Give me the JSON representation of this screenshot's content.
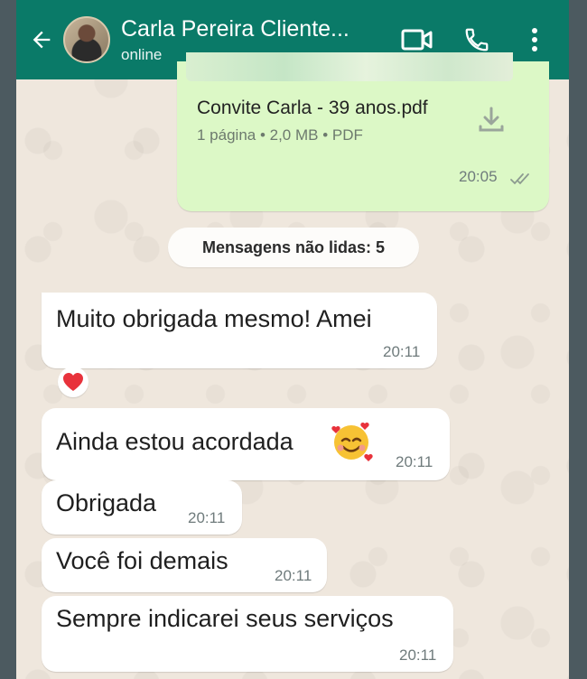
{
  "header": {
    "contact_name": "Carla Pereira Cliente...",
    "status": "online"
  },
  "icons": {
    "back": "arrow-left-icon",
    "video": "video-call-icon",
    "phone": "phone-icon",
    "menu": "more-vert-icon",
    "download": "download-icon",
    "read_receipt": "double-check-icon",
    "reaction": "red-heart"
  },
  "colors": {
    "header": "#0a7a68",
    "outgoing_bubble": "#dcf8c6",
    "incoming_bubble": "#ffffff",
    "chat_background": "#efe7dd"
  },
  "file_message": {
    "filename": "Convite Carla - 39 anos.pdf",
    "meta": "1 página • 2,0 MB • PDF",
    "time": "20:05"
  },
  "unread_label": "Mensagens não lidas: 5",
  "messages": [
    {
      "text": "Muito obrigada mesmo! Amei",
      "time": "20:11"
    },
    {
      "text": "Ainda estou acordada",
      "time": "20:11"
    },
    {
      "text": "Obrigada",
      "time": "20:11"
    },
    {
      "text": "Você foi demais",
      "time": "20:11"
    },
    {
      "text": "Sempre indicarei seus serviços",
      "time": "20:11"
    }
  ]
}
